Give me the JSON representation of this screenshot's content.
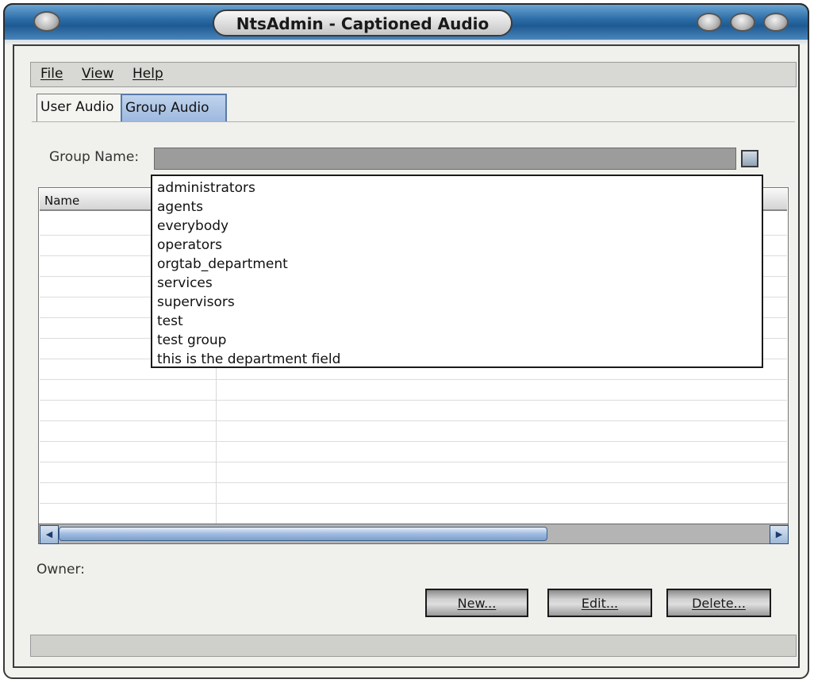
{
  "window": {
    "title": "NtsAdmin - Captioned Audio"
  },
  "menubar": {
    "items": [
      {
        "label": "File"
      },
      {
        "label": "View"
      },
      {
        "label": "Help"
      }
    ]
  },
  "tabs": [
    {
      "label": "User Audio",
      "active": false
    },
    {
      "label": "Group Audio",
      "active": true
    }
  ],
  "group": {
    "label": "Group Name:",
    "value": "",
    "options": [
      "administrators",
      "agents",
      "everybody",
      "operators",
      "orgtab_department",
      "services",
      "supervisors",
      "test",
      "test group",
      "this is the department field"
    ]
  },
  "table": {
    "columns": [
      "Name"
    ]
  },
  "owner": {
    "label": "Owner:"
  },
  "buttons": {
    "new": "New...",
    "edit": "Edit...",
    "delete": "Delete..."
  },
  "icons": {
    "scroll_left": "scroll-left-icon",
    "scroll_right": "scroll-right-icon",
    "combo_dropdown": "dropdown-icon"
  },
  "colors": {
    "title_blue": "#2e6ea8",
    "scroll_accent": "#9fbbe0"
  }
}
